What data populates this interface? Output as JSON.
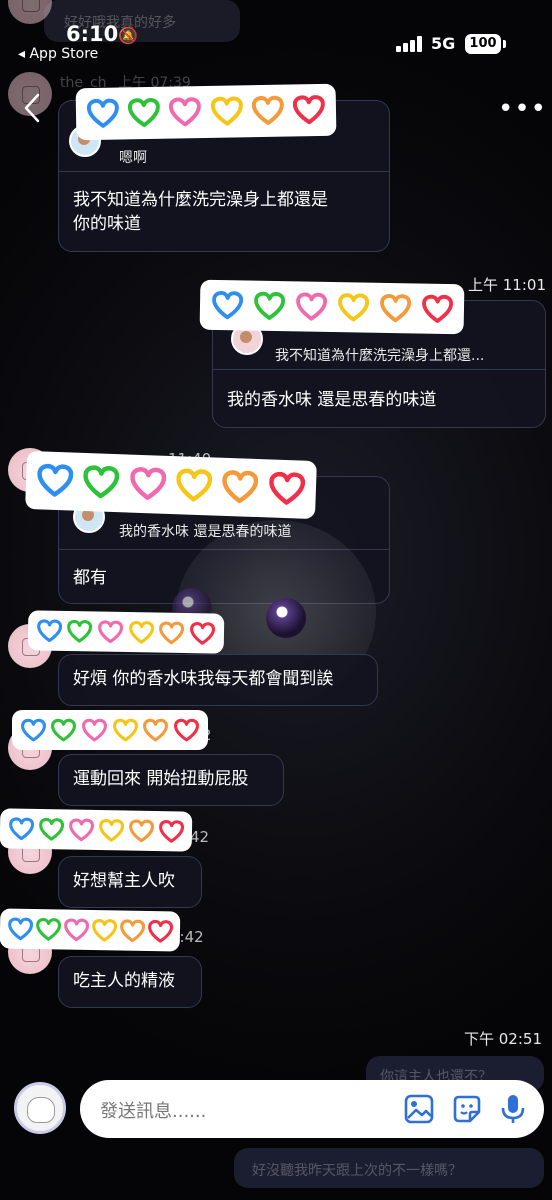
{
  "status_bar": {
    "time": "6:10",
    "back_app": "◂ App Store",
    "network": "5G",
    "battery": "100"
  },
  "ghost_top": {
    "top_text": "好好哦我真的好多",
    "name_time": "the_ch_ 上午 07:39"
  },
  "messages": [
    {
      "id": "m1",
      "quote": "嗯啊",
      "body_lines": [
        "我不知道為什麼洗完澡身上都還是",
        "你的味道"
      ]
    },
    {
      "id": "m2",
      "time": "上午 11:01",
      "quote": "我不知道為什麼洗完澡身上都還...",
      "body": "我的香水味 還是思春的味道"
    },
    {
      "id": "m3",
      "time_fragment": "11:40",
      "quote": "我的香水味 還是思春的味道",
      "body": "都有"
    },
    {
      "id": "m4",
      "body": "好煩 你的香水味我每天都會聞到誒"
    },
    {
      "id": "m5",
      "time_fragment": "2",
      "body": "運動回來 開始扭動屁股"
    },
    {
      "id": "m6",
      "time_fragment": "42",
      "body": "好想幫主人吹"
    },
    {
      "id": "m7",
      "time_fragment": "2:42",
      "body": "吃主人的精液"
    }
  ],
  "sent_time": "下午 02:51",
  "bottom_ghost": {
    "line1": "你這主人也還不？",
    "line2": "好沒聽我昨天跟上次的不一樣嗎？"
  },
  "composer": {
    "placeholder": "發送訊息......"
  },
  "colors": {
    "background": "#0a0a0e",
    "bubble_border": "#343750",
    "heart_colors": [
      "#2f8ff0",
      "#2ec13a",
      "#f06ab0",
      "#f5c518",
      "#f59a3a",
      "#f0304a"
    ],
    "icon_accent": "#2f6fd8"
  }
}
